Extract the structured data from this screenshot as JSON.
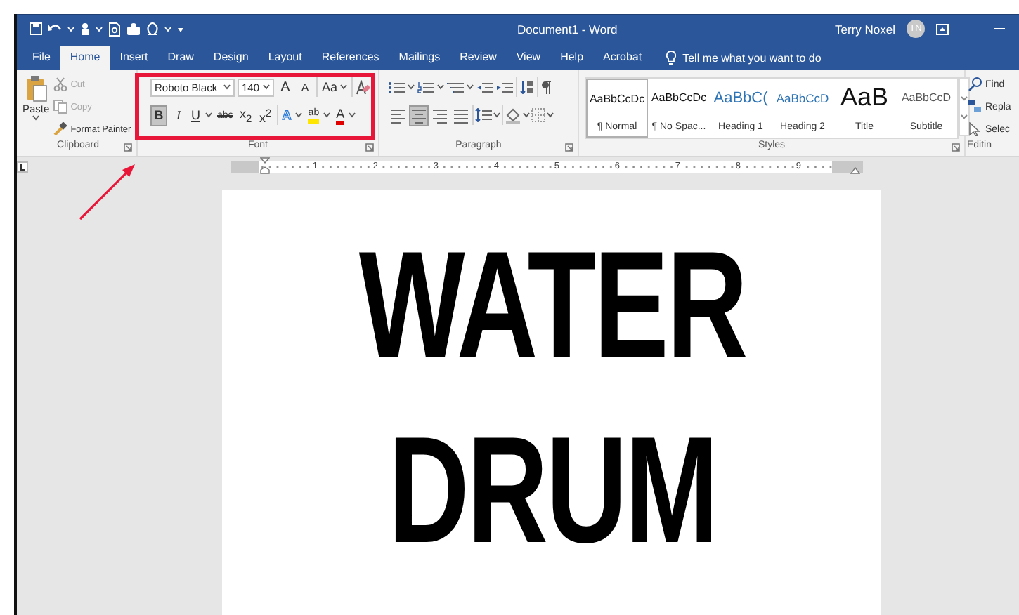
{
  "window": {
    "title": "Document1  -  Word",
    "user": "Terry Noxel",
    "avatar_initials": "TN"
  },
  "tabs": [
    {
      "label": "File",
      "selected": false
    },
    {
      "label": "Home",
      "selected": true
    },
    {
      "label": "Insert",
      "selected": false
    },
    {
      "label": "Draw",
      "selected": false
    },
    {
      "label": "Design",
      "selected": false
    },
    {
      "label": "Layout",
      "selected": false
    },
    {
      "label": "References",
      "selected": false
    },
    {
      "label": "Mailings",
      "selected": false
    },
    {
      "label": "Review",
      "selected": false
    },
    {
      "label": "View",
      "selected": false
    },
    {
      "label": "Help",
      "selected": false
    },
    {
      "label": "Acrobat",
      "selected": false
    }
  ],
  "tell_me": {
    "placeholder": "Tell me what you want to do"
  },
  "clipboard": {
    "label": "Clipboard",
    "paste": "Paste",
    "items": [
      {
        "kind": "cut",
        "label": "Cut",
        "disabled": true
      },
      {
        "kind": "copy",
        "label": "Copy",
        "disabled": true
      },
      {
        "kind": "painter",
        "label": "Format Painter",
        "disabled": false
      }
    ]
  },
  "font": {
    "label": "Font",
    "name": "Roboto Black",
    "size": "140",
    "grow": "A",
    "shrink": "A",
    "change_case": "Aa",
    "buttons": [
      {
        "kind": "bold",
        "label": "B",
        "selected": true
      },
      {
        "kind": "italic",
        "label": "I",
        "selected": false
      },
      {
        "kind": "underline",
        "label": "U",
        "selected": false
      },
      {
        "kind": "strike",
        "label": "abc",
        "selected": false
      },
      {
        "kind": "script",
        "label": "x$_{2}$",
        "selected": false
      },
      {
        "kind": "script",
        "label": "x$^{2}$",
        "selected": false
      },
      {
        "kind": "effects",
        "label": "A",
        "selected": false
      },
      {
        "kind": "highlight",
        "label": "ab",
        "selected": false
      },
      {
        "kind": "color",
        "label": "A",
        "selected": false
      }
    ]
  },
  "paragraph": {
    "label": "Paragraph",
    "alignments": [
      {
        "kind": "left",
        "selected": false
      },
      {
        "kind": "center",
        "selected": true
      },
      {
        "kind": "right",
        "selected": false
      },
      {
        "kind": "justify",
        "selected": false
      }
    ]
  },
  "styles": {
    "label": "Styles",
    "items": [
      {
        "kind": "normal",
        "preview": "AaBbCcDc",
        "name": "¶ Normal",
        "selected": true
      },
      {
        "kind": "normal",
        "preview": "AaBbCcDc",
        "name": "¶ No Spac...",
        "selected": false
      },
      {
        "kind": "heading1",
        "preview": "AaBbC(",
        "name": "Heading 1",
        "selected": false
      },
      {
        "kind": "heading2",
        "preview": "AaBbCcD",
        "name": "Heading 2",
        "selected": false
      },
      {
        "kind": "title",
        "preview": "AaB",
        "name": "Title",
        "selected": false
      },
      {
        "kind": "subtitle",
        "preview": "AaBbCcD",
        "name": "Subtitle",
        "selected": false
      }
    ]
  },
  "editing": {
    "label": "Editin",
    "items": [
      {
        "kind": "find",
        "label": "Find"
      },
      {
        "kind": "replace",
        "label": "Repla"
      },
      {
        "kind": "select",
        "label": "Selec"
      }
    ]
  },
  "ruler": {
    "numbers": [
      "1",
      "2",
      "3",
      "4",
      "5",
      "6",
      "7",
      "8",
      "9"
    ]
  },
  "document": {
    "lines": [
      "WATER",
      "DRUM"
    ]
  }
}
